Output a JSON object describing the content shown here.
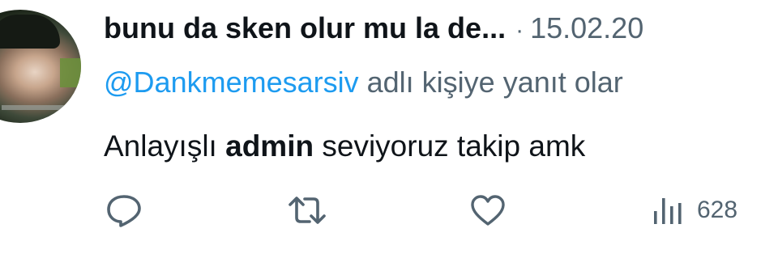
{
  "tweet": {
    "author_name": "bunu da sken olur mu la de...",
    "separator": "·",
    "date": "15.02.20",
    "reply_to_handle": "@Dankmemesarsiv",
    "reply_suffix": " adlı kişiye yanıt olar",
    "body_before": "Anlayışlı ",
    "body_bold": "admin",
    "body_after": " seviyoruz takip amk"
  },
  "actions": {
    "reply_icon": "reply-icon",
    "retweet_icon": "retweet-icon",
    "like_icon": "heart-icon",
    "views_icon": "views-chart-icon",
    "views_count": "628"
  },
  "colors": {
    "text": "#0f1419",
    "secondary": "#536471",
    "link": "#1d9bf0",
    "background": "#ffffff"
  }
}
